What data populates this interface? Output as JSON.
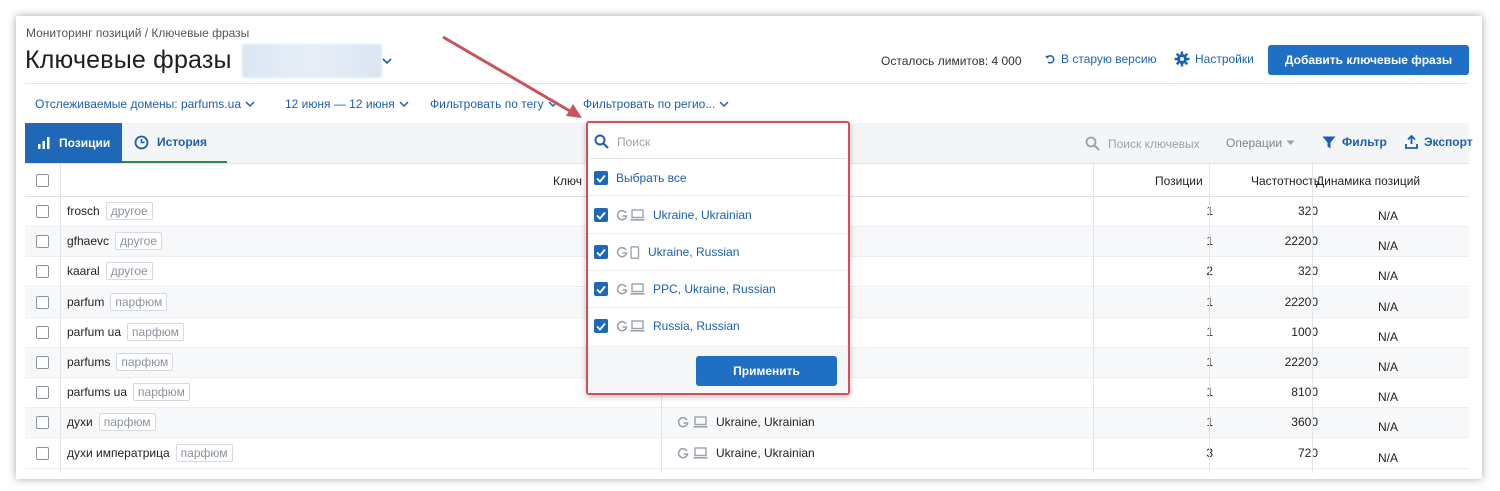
{
  "breadcrumb": "Мониторинг позиций / Ключевые фразы",
  "page_title": "Ключевые фразы",
  "header": {
    "limits": "Осталось лимитов: 4 000",
    "old_version": "В старую версию",
    "settings": "Настройки",
    "add_button": "Добавить ключевые фразы"
  },
  "filters": {
    "domains": "Отслеживаемые домены: parfums.ua",
    "dates": "12 июня — 12 июня",
    "tag": "Фильтровать по тегу",
    "region": "Фильтровать по регио..."
  },
  "tabs": {
    "positions": "Позиции",
    "history": "История"
  },
  "toolbar": {
    "search_placeholder": "Поиск ключевых",
    "operations": "Операции",
    "filter": "Фильтр",
    "export": "Экспорт"
  },
  "table": {
    "headers": {
      "keyword": "Ключ",
      "positions": "Позиции",
      "frequency": "Частотность",
      "dynamics": "Динамика позиций"
    },
    "rows": [
      {
        "keyword": "frosch",
        "tag": "другое",
        "position": "1",
        "frequency": "320",
        "dynamics": "N/A",
        "region": ""
      },
      {
        "keyword": "gfhaevc",
        "tag": "другое",
        "position": "1",
        "frequency": "22200",
        "dynamics": "N/A",
        "region": ""
      },
      {
        "keyword": "kaaral",
        "tag": "другое",
        "position": "2",
        "frequency": "320",
        "dynamics": "N/A",
        "region": ""
      },
      {
        "keyword": "parfum",
        "tag": "парфюм",
        "position": "1",
        "frequency": "22200",
        "dynamics": "N/A",
        "region": ""
      },
      {
        "keyword": "parfum ua",
        "tag": "парфюм",
        "position": "1",
        "frequency": "1000",
        "dynamics": "N/A",
        "region": ""
      },
      {
        "keyword": "parfums",
        "tag": "парфюм",
        "position": "1",
        "frequency": "22200",
        "dynamics": "N/A",
        "region": ""
      },
      {
        "keyword": "parfums ua",
        "tag": "парфюм",
        "position": "1",
        "frequency": "8100",
        "dynamics": "N/A",
        "region": ""
      },
      {
        "keyword": "духи",
        "tag": "парфюм",
        "position": "1",
        "frequency": "3600",
        "dynamics": "N/A",
        "region": "Ukraine, Ukrainian"
      },
      {
        "keyword": "духи императрица",
        "tag": "парфюм",
        "position": "3",
        "frequency": "720",
        "dynamics": "N/A",
        "region": "Ukraine, Ukrainian"
      }
    ]
  },
  "region_dropdown": {
    "search_placeholder": "Поиск",
    "select_all": "Выбрать все",
    "options": [
      {
        "label": "Ukraine, Ukrainian",
        "device": "desktop"
      },
      {
        "label": "Ukraine, Russian",
        "device": "mobile"
      },
      {
        "label": "PPC, Ukraine, Russian",
        "device": "desktop"
      },
      {
        "label": "Russia, Russian",
        "device": "desktop"
      }
    ],
    "apply": "Применить"
  },
  "colors": {
    "primary": "#1f6fc4",
    "link": "#1b5fae",
    "highlight_border": "#d0515a"
  }
}
